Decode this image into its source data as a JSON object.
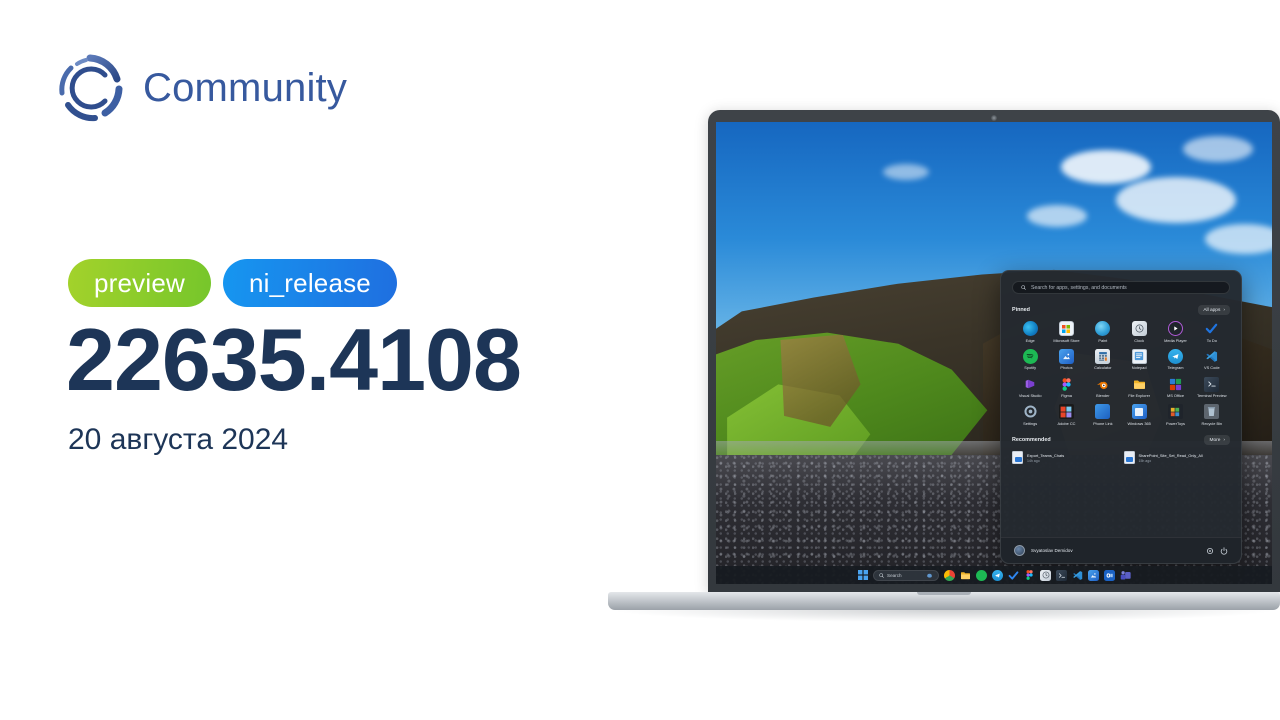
{
  "brand": {
    "name": "Community",
    "logo_icon": "community-circle-logo",
    "color": "#37599e"
  },
  "release": {
    "badges": [
      {
        "label": "preview",
        "color": "#8ccb2a"
      },
      {
        "label": "ni_release",
        "color": "#1b82e8"
      }
    ],
    "build_number": "22635.4108",
    "date": "20 августа 2024",
    "text_color": "#1d3557"
  },
  "device": {
    "type": "laptop",
    "bezel_color": "#3a3f44",
    "base_color": "#c3c8cd"
  },
  "wallpaper": {
    "description": "Iceland cliff with green moss, blue sky and black pebble beach"
  },
  "start_menu": {
    "search": {
      "placeholder": "Search for apps, settings, and documents",
      "icon": "search-icon"
    },
    "pinned": {
      "title": "Pinned",
      "all_apps_label": "All apps",
      "chevron": "›",
      "apps": [
        {
          "label": "Edge",
          "icon": "edge-icon",
          "color": "#0f7dc2"
        },
        {
          "label": "Microsoft Store",
          "icon": "microsoft-store-icon",
          "color": "#e8eef5"
        },
        {
          "label": "Paint",
          "icon": "paint-icon",
          "color": "#2aa7e0"
        },
        {
          "label": "Clock",
          "icon": "clock-icon",
          "color": "#d7dde3"
        },
        {
          "label": "Media Player",
          "icon": "media-player-icon",
          "color": "#2a2f36"
        },
        {
          "label": "To Do",
          "icon": "todo-icon",
          "color": "#1d6fe0"
        },
        {
          "label": "Spotify",
          "icon": "spotify-icon",
          "color": "#1db954"
        },
        {
          "label": "Photos",
          "icon": "photos-icon",
          "color": "#2b7ad8"
        },
        {
          "label": "Calculator",
          "icon": "calculator-icon",
          "color": "#4b7ea8"
        },
        {
          "label": "Notepad",
          "icon": "notepad-icon",
          "color": "#3f8fd0"
        },
        {
          "label": "Telegram",
          "icon": "telegram-icon",
          "color": "#2aabee"
        },
        {
          "label": "VS Code",
          "icon": "vscode-icon",
          "color": "#2b8fd8"
        },
        {
          "label": "Visual Studio",
          "icon": "visual-studio-icon",
          "color": "#8b50d8"
        },
        {
          "label": "Figma",
          "icon": "figma-icon",
          "color": "#f24e1e"
        },
        {
          "label": "Blender",
          "icon": "blender-icon",
          "color": "#ea7600"
        },
        {
          "label": "File Explorer",
          "icon": "file-explorer-icon",
          "color": "#f5bf4a"
        },
        {
          "label": "MS Office",
          "icon": "ms-office-icon",
          "color": "#d83b01"
        },
        {
          "label": "Terminal Preview",
          "icon": "terminal-icon",
          "color": "#2b3a4a"
        },
        {
          "label": "Settings",
          "icon": "settings-gear-icon",
          "color": "#8fa3b5"
        },
        {
          "label": "Adobe CC",
          "icon": "adobe-cc-icon",
          "color": "#da1f26"
        },
        {
          "label": "Phone Link",
          "icon": "phone-link-icon",
          "color": "#1f7ad8"
        },
        {
          "label": "Windows 365",
          "icon": "windows-365-icon",
          "color": "#2b7ad8"
        },
        {
          "label": "PowerToys",
          "icon": "powertoys-icon",
          "color": "#e8b32a"
        },
        {
          "label": "Recycle Bin",
          "icon": "recycle-bin-icon",
          "color": "#9fb3c4"
        }
      ]
    },
    "recommended": {
      "title": "Recommended",
      "more_label": "More",
      "chevron": "›",
      "items": [
        {
          "name": "Export_Teams_Chats",
          "time": "14h ago",
          "icon": "document-icon"
        },
        {
          "name": "SharePoint_Site_Set_Read_Only_All",
          "time": "15h ago",
          "icon": "document-icon"
        }
      ]
    },
    "user": {
      "name": "Svyatoslav Demidov",
      "avatar_icon": "user-avatar",
      "settings_icon": "settings-icon",
      "power_icon": "power-icon"
    }
  },
  "taskbar": {
    "start_icon": "windows-start-icon",
    "search_label": "Search",
    "search_icon": "search-icon",
    "copilot_icon": "copilot-icon",
    "apps": [
      {
        "name": "Chrome",
        "icon": "chrome-icon",
        "color": "#4a8cf0"
      },
      {
        "name": "File Explorer",
        "icon": "file-explorer-icon",
        "color": "#f5bf4a"
      },
      {
        "name": "Spotify",
        "icon": "spotify-icon",
        "color": "#1db954"
      },
      {
        "name": "Telegram",
        "icon": "telegram-icon",
        "color": "#2aabee"
      },
      {
        "name": "To Do",
        "icon": "todo-icon",
        "color": "#1d6fe0"
      },
      {
        "name": "Figma",
        "icon": "figma-icon",
        "color": "#f24e1e"
      },
      {
        "name": "Clock",
        "icon": "clock-icon",
        "color": "#d7dde3"
      },
      {
        "name": "Terminal",
        "icon": "terminal-icon",
        "color": "#2b3a4a"
      },
      {
        "name": "VS Code",
        "icon": "vscode-icon",
        "color": "#2b8fd8"
      },
      {
        "name": "Photos",
        "icon": "photos-icon",
        "color": "#2b7ad8"
      },
      {
        "name": "Outlook",
        "icon": "outlook-icon",
        "color": "#1b62c4"
      },
      {
        "name": "Teams",
        "icon": "teams-icon",
        "color": "#5b5fc7"
      }
    ]
  }
}
